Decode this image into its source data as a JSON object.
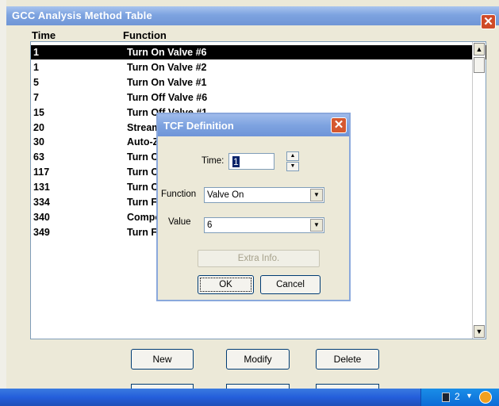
{
  "window": {
    "title": "GCC Analysis Method Table",
    "close_glyph": "✕"
  },
  "table": {
    "headers": {
      "time": "Time",
      "function": "Function"
    },
    "rows": [
      {
        "time": "1",
        "function": "Turn On Valve #6",
        "selected": true
      },
      {
        "time": "1",
        "function": "Turn On Valve #2"
      },
      {
        "time": "5",
        "function": "Turn On Valve #1"
      },
      {
        "time": "7",
        "function": "Turn Off Valve #6"
      },
      {
        "time": "15",
        "function": "Turn Off Valve #1"
      },
      {
        "time": "20",
        "function": "Stream"
      },
      {
        "time": "30",
        "function": "Auto-Z"
      },
      {
        "time": "63",
        "function": "Turn C"
      },
      {
        "time": "117",
        "function": "Turn C"
      },
      {
        "time": "131",
        "function": "Turn C"
      },
      {
        "time": "334",
        "function": "Turn F"
      },
      {
        "time": "340",
        "function": "Compo"
      },
      {
        "time": "349",
        "function": "Turn F"
      }
    ]
  },
  "buttons": {
    "new": "New",
    "modify": "Modify",
    "delete": "Delete"
  },
  "dialog": {
    "title": "TCF Definition",
    "close_glyph": "✕",
    "time_label": "Time:",
    "time_value": "1",
    "function_label": "Function",
    "function_value": "Valve On",
    "value_label": "Value",
    "value_value": "6",
    "extra_info_label": "Extra Info.",
    "ok_label": "OK",
    "cancel_label": "Cancel"
  },
  "taskbar": {
    "tray_count": "2"
  },
  "icons": {
    "scroll_up": "▲",
    "scroll_down": "▼",
    "dropdown": "▼",
    "spin_up": "▲",
    "spin_down": "▼"
  }
}
